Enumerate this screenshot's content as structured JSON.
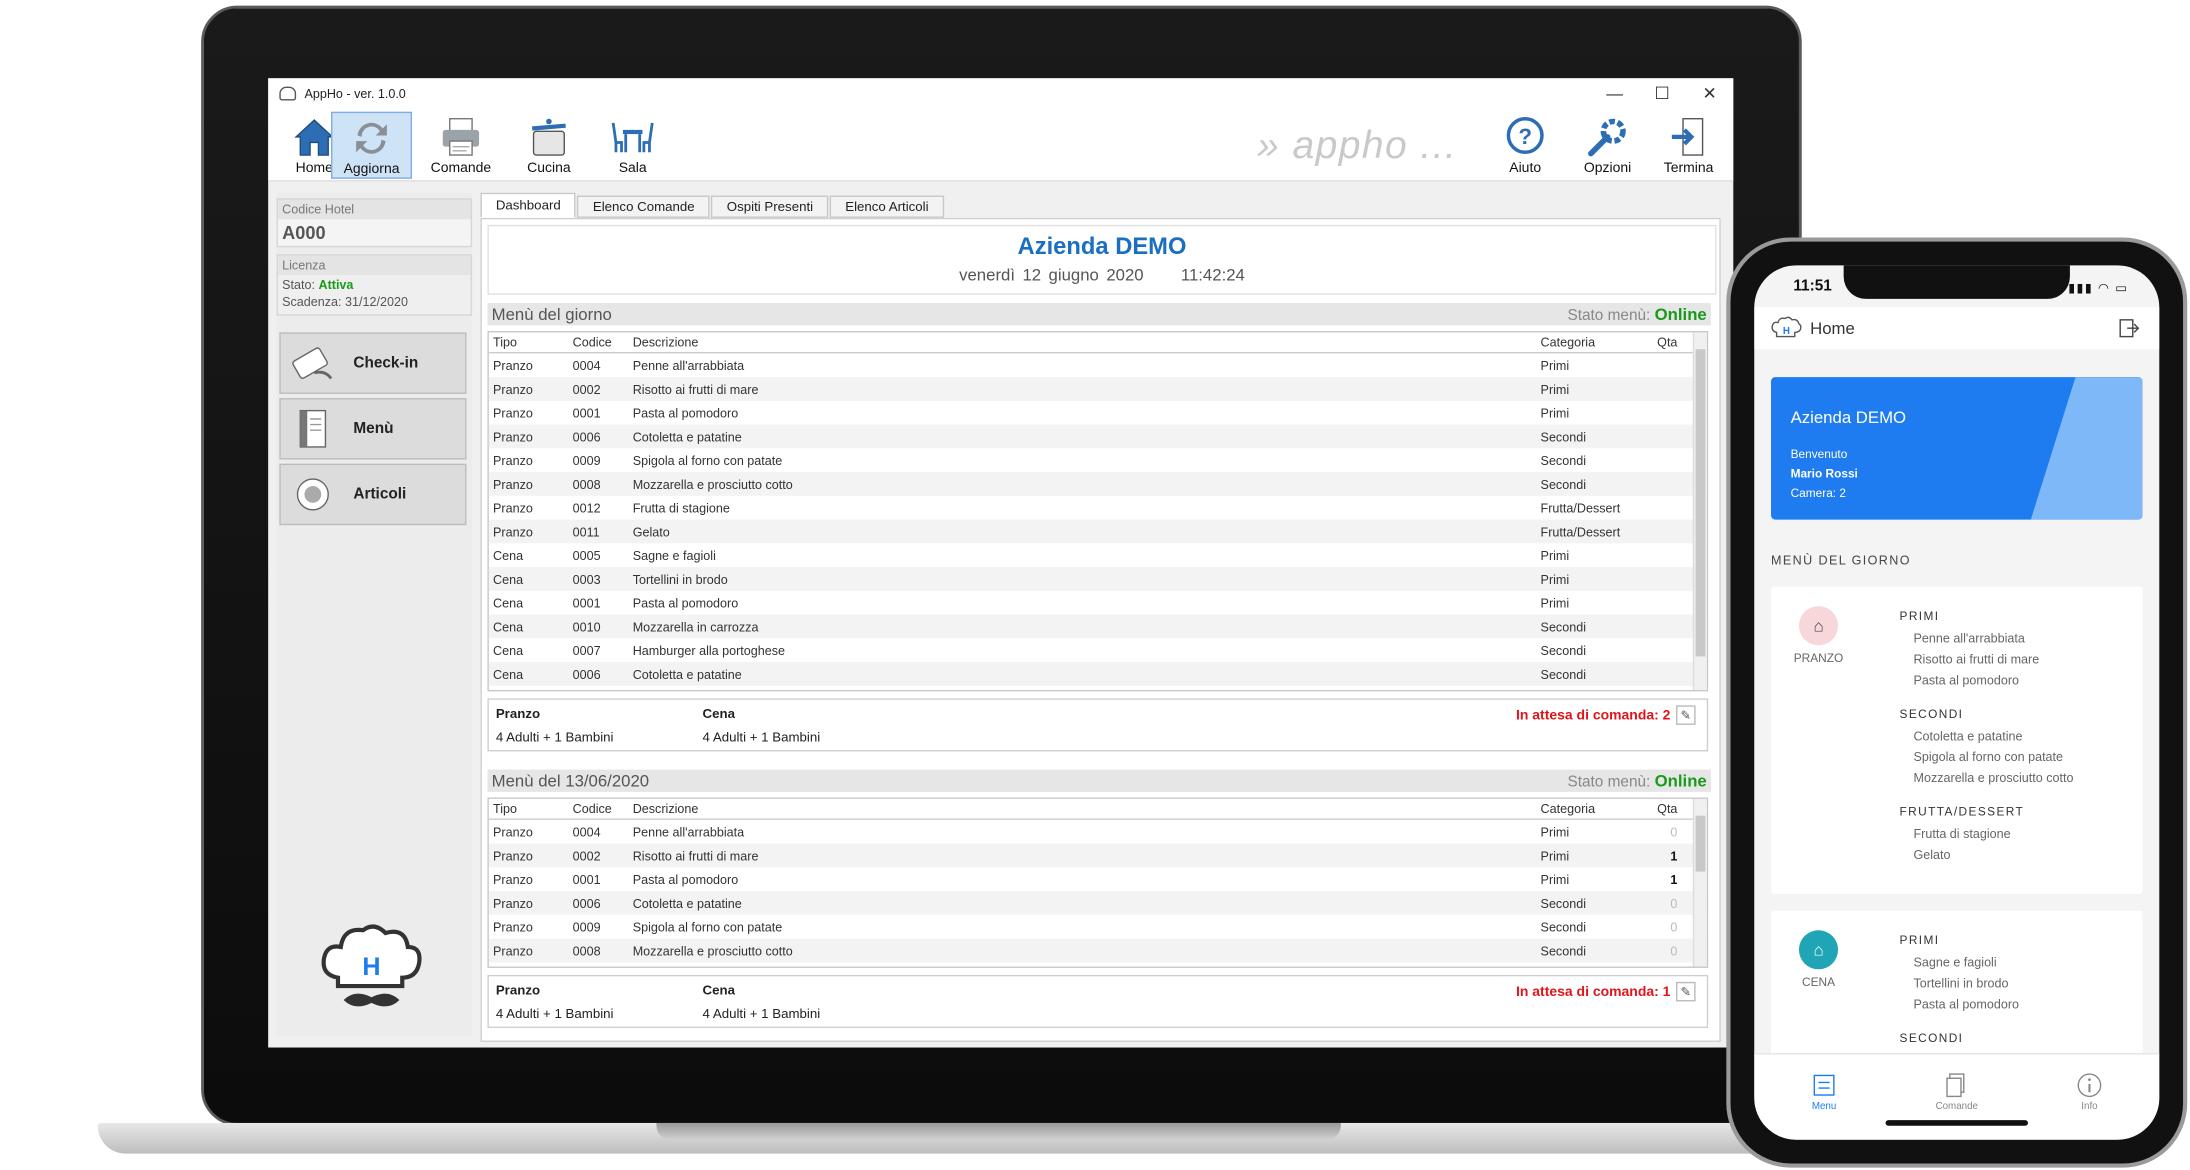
{
  "window": {
    "title": "AppHo -  ver. 1.0.0",
    "buttons": [
      "—",
      "☐",
      "✕"
    ]
  },
  "toolbar": {
    "home": "Home",
    "refresh": "Aggiorna",
    "orders": "Comande",
    "kitchen": "Cucina",
    "hall": "Sala",
    "brand": "» appho ...",
    "help": "Aiuto",
    "options": "Opzioni",
    "exit": "Termina"
  },
  "sidebar": {
    "hotel_label": "Codice Hotel",
    "hotel_code": "A000",
    "license_label": "Licenza",
    "status_label": "Stato:",
    "status_value": "Attiva",
    "expiry_label": "Scadenza:",
    "expiry_value": "31/12/2020",
    "checkin": "Check-in",
    "menu": "Menù",
    "articles": "Articoli"
  },
  "tabs": [
    "Dashboard",
    "Elenco Comande",
    "Ospiti Presenti",
    "Elenco Articoli"
  ],
  "dashboard": {
    "company": "Azienda DEMO",
    "date": "venerdì 12 giugno 2020",
    "time": "11:42:24"
  },
  "columns": {
    "type": "Tipo",
    "code": "Codice",
    "desc": "Descrizione",
    "cat": "Categoria",
    "qty": "Qta"
  },
  "menu_today": {
    "title": "Menù del giorno",
    "status_label": "Stato menù:",
    "status": "Online",
    "rows": [
      [
        "Pranzo",
        "0004",
        "Penne all'arrabbiata",
        "Primi",
        ""
      ],
      [
        "Pranzo",
        "0002",
        "Risotto ai frutti di mare",
        "Primi",
        ""
      ],
      [
        "Pranzo",
        "0001",
        "Pasta al pomodoro",
        "Primi",
        ""
      ],
      [
        "Pranzo",
        "0006",
        "Cotoletta e patatine",
        "Secondi",
        ""
      ],
      [
        "Pranzo",
        "0009",
        "Spigola al forno con patate",
        "Secondi",
        ""
      ],
      [
        "Pranzo",
        "0008",
        "Mozzarella e prosciutto cotto",
        "Secondi",
        ""
      ],
      [
        "Pranzo",
        "0012",
        "Frutta di stagione",
        "Frutta/Dessert",
        ""
      ],
      [
        "Pranzo",
        "0011",
        "Gelato",
        "Frutta/Dessert",
        ""
      ],
      [
        "Cena",
        "0005",
        "Sagne e fagioli",
        "Primi",
        ""
      ],
      [
        "Cena",
        "0003",
        "Tortellini in brodo",
        "Primi",
        ""
      ],
      [
        "Cena",
        "0001",
        "Pasta al pomodoro",
        "Primi",
        ""
      ],
      [
        "Cena",
        "0010",
        "Mozzarella in carrozza",
        "Secondi",
        ""
      ],
      [
        "Cena",
        "0007",
        "Hamburger alla portoghese",
        "Secondi",
        ""
      ],
      [
        "Cena",
        "0006",
        "Cotoletta e patatine",
        "Secondi",
        ""
      ]
    ],
    "lunch_label": "Pranzo",
    "lunch_value": "4 Adulti + 1 Bambini",
    "dinner_label": "Cena",
    "dinner_value": "4 Adulti + 1 Bambini",
    "waiting": "In attesa di comanda: 2"
  },
  "menu_next": {
    "title": "Menù del 13/06/2020",
    "status_label": "Stato menù:",
    "status": "Online",
    "rows": [
      [
        "Pranzo",
        "0004",
        "Penne all'arrabbiata",
        "Primi",
        "0"
      ],
      [
        "Pranzo",
        "0002",
        "Risotto ai frutti di mare",
        "Primi",
        "1"
      ],
      [
        "Pranzo",
        "0001",
        "Pasta al pomodoro",
        "Primi",
        "1"
      ],
      [
        "Pranzo",
        "0006",
        "Cotoletta e patatine",
        "Secondi",
        "0"
      ],
      [
        "Pranzo",
        "0009",
        "Spigola al forno con patate",
        "Secondi",
        "0"
      ],
      [
        "Pranzo",
        "0008",
        "Mozzarella e prosciutto cotto",
        "Secondi",
        "0"
      ]
    ],
    "lunch_label": "Pranzo",
    "lunch_value": "4 Adulti + 1 Bambini",
    "dinner_label": "Cena",
    "dinner_value": "4 Adulti + 1 Bambini",
    "waiting": "In attesa di comanda: 1"
  },
  "phone": {
    "time": "11:51",
    "status_icons": "▮▮▮ ◠ ▭",
    "header": "Home",
    "card": {
      "company": "Azienda DEMO",
      "welcome": "Benvenuto",
      "name": "Mario Rossi",
      "room": "Camera: 2"
    },
    "section": "MENÙ DEL GIORNO",
    "lunch": {
      "label": "PRANZO",
      "groups": [
        {
          "cat": "PRIMI",
          "items": [
            "Penne all'arrabbiata",
            "Risotto ai frutti di mare",
            "Pasta al pomodoro"
          ]
        },
        {
          "cat": "SECONDI",
          "items": [
            "Cotoletta e patatine",
            "Spigola al forno con patate",
            "Mozzarella e prosciutto cotto"
          ]
        },
        {
          "cat": "FRUTTA/DESSERT",
          "items": [
            "Frutta di stagione",
            "Gelato"
          ]
        }
      ]
    },
    "dinner": {
      "label": "CENA",
      "groups": [
        {
          "cat": "PRIMI",
          "items": [
            "Sagne e fagioli",
            "Tortellini in brodo",
            "Pasta al pomodoro"
          ]
        },
        {
          "cat": "SECONDI",
          "items": []
        }
      ]
    },
    "tabs": [
      "Menu",
      "Comande",
      "Info"
    ]
  },
  "colors": {
    "accent": "#1b6fc0",
    "online": "#1a9a1a",
    "alert": "#e2141a",
    "phone_card": "#1e7bf0"
  }
}
